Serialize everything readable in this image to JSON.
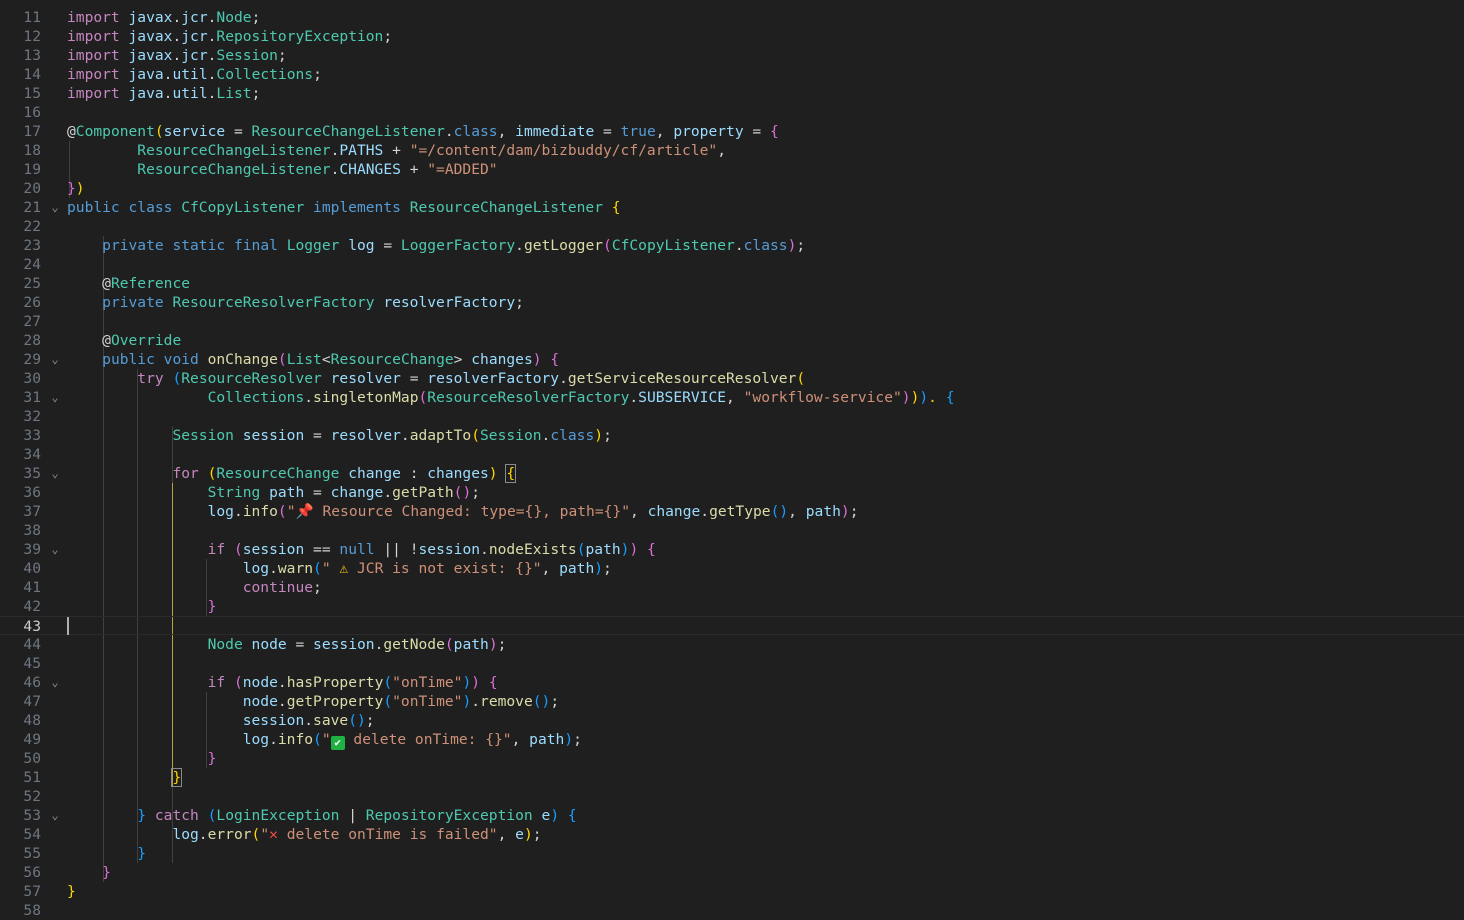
{
  "editor": {
    "active_line": 43,
    "colors": {
      "background": "#1f1f1f",
      "line_number": "#6e7681",
      "keyword": "#569cd6",
      "control": "#c586c0",
      "type": "#4ec9b0",
      "variable": "#9cdcfe",
      "function": "#dcdcaa",
      "string": "#ce9178"
    },
    "line_numbers": [
      "11",
      "12",
      "13",
      "14",
      "15",
      "16",
      "17",
      "18",
      "19",
      "20",
      "21",
      "22",
      "23",
      "24",
      "25",
      "26",
      "27",
      "28",
      "29",
      "30",
      "31",
      "32",
      "33",
      "34",
      "35",
      "36",
      "37",
      "38",
      "39",
      "40",
      "41",
      "42",
      "43",
      "44",
      "45",
      "46",
      "47",
      "48",
      "49",
      "50",
      "51",
      "52",
      "53",
      "54",
      "55",
      "56",
      "57",
      "58"
    ],
    "lines": [
      [
        [
          "kc",
          "import "
        ],
        [
          "v",
          "javax"
        ],
        [
          "p",
          "."
        ],
        [
          "v",
          "jcr"
        ],
        [
          "p",
          "."
        ],
        [
          "t",
          "Node"
        ],
        [
          "p",
          ";"
        ]
      ],
      [
        [
          "kc",
          "import "
        ],
        [
          "v",
          "javax"
        ],
        [
          "p",
          "."
        ],
        [
          "v",
          "jcr"
        ],
        [
          "p",
          "."
        ],
        [
          "t",
          "RepositoryException"
        ],
        [
          "p",
          ";"
        ]
      ],
      [
        [
          "kc",
          "import "
        ],
        [
          "v",
          "javax"
        ],
        [
          "p",
          "."
        ],
        [
          "v",
          "jcr"
        ],
        [
          "p",
          "."
        ],
        [
          "t",
          "Session"
        ],
        [
          "p",
          ";"
        ]
      ],
      [
        [
          "kc",
          "import "
        ],
        [
          "v",
          "java"
        ],
        [
          "p",
          "."
        ],
        [
          "v",
          "util"
        ],
        [
          "p",
          "."
        ],
        [
          "t",
          "Collections"
        ],
        [
          "p",
          ";"
        ]
      ],
      [
        [
          "kc",
          "import "
        ],
        [
          "v",
          "java"
        ],
        [
          "p",
          "."
        ],
        [
          "v",
          "util"
        ],
        [
          "p",
          "."
        ],
        [
          "t",
          "List"
        ],
        [
          "p",
          ";"
        ]
      ],
      [],
      [
        [
          "p",
          "@"
        ],
        [
          "t",
          "Component"
        ],
        [
          "b1",
          "("
        ],
        [
          "v",
          "service"
        ],
        [
          "p",
          " = "
        ],
        [
          "t",
          "ResourceChangeListener"
        ],
        [
          "p",
          "."
        ],
        [
          "k",
          "class"
        ],
        [
          "p",
          ", "
        ],
        [
          "v",
          "immediate"
        ],
        [
          "p",
          " = "
        ],
        [
          "k",
          "true"
        ],
        [
          "p",
          ", "
        ],
        [
          "v",
          "property"
        ],
        [
          "p",
          " = "
        ],
        [
          "b2",
          "{"
        ]
      ],
      [
        [
          "p",
          "        "
        ],
        [
          "t",
          "ResourceChangeListener"
        ],
        [
          "p",
          "."
        ],
        [
          "v",
          "PATHS"
        ],
        [
          "p",
          " + "
        ],
        [
          "s",
          "\"=/content/dam/bizbuddy/cf/article\""
        ],
        [
          "p",
          ","
        ]
      ],
      [
        [
          "p",
          "        "
        ],
        [
          "t",
          "ResourceChangeListener"
        ],
        [
          "p",
          "."
        ],
        [
          "v",
          "CHANGES"
        ],
        [
          "p",
          " + "
        ],
        [
          "s",
          "\"=ADDED\""
        ]
      ],
      [
        [
          "b2",
          "}"
        ],
        [
          "b1",
          ")"
        ]
      ],
      [
        [
          "k",
          "public "
        ],
        [
          "k",
          "class "
        ],
        [
          "t",
          "CfCopyListener "
        ],
        [
          "k",
          "implements "
        ],
        [
          "t",
          "ResourceChangeListener "
        ],
        [
          "b1",
          "{"
        ]
      ],
      [],
      [
        [
          "p",
          "    "
        ],
        [
          "k",
          "private "
        ],
        [
          "k",
          "static "
        ],
        [
          "k",
          "final "
        ],
        [
          "t",
          "Logger "
        ],
        [
          "v",
          "log"
        ],
        [
          "p",
          " = "
        ],
        [
          "t",
          "LoggerFactory"
        ],
        [
          "p",
          "."
        ],
        [
          "f",
          "getLogger"
        ],
        [
          "b2",
          "("
        ],
        [
          "t",
          "CfCopyListener"
        ],
        [
          "p",
          "."
        ],
        [
          "k",
          "class"
        ],
        [
          "b2",
          ")"
        ],
        [
          "p",
          ";"
        ]
      ],
      [],
      [
        [
          "p",
          "    @"
        ],
        [
          "t",
          "Reference"
        ]
      ],
      [
        [
          "p",
          "    "
        ],
        [
          "k",
          "private "
        ],
        [
          "t",
          "ResourceResolverFactory "
        ],
        [
          "v",
          "resolverFactory"
        ],
        [
          "p",
          ";"
        ]
      ],
      [],
      [
        [
          "p",
          "    @"
        ],
        [
          "t",
          "Override"
        ]
      ],
      [
        [
          "p",
          "    "
        ],
        [
          "k",
          "public "
        ],
        [
          "k",
          "void "
        ],
        [
          "f",
          "onChange"
        ],
        [
          "b2",
          "("
        ],
        [
          "t",
          "List"
        ],
        [
          "p",
          "<"
        ],
        [
          "t",
          "ResourceChange"
        ],
        [
          "p",
          "> "
        ],
        [
          "v",
          "changes"
        ],
        [
          "b2",
          ")"
        ],
        [
          "p",
          " "
        ],
        [
          "b2",
          "{"
        ]
      ],
      [
        [
          "p",
          "        "
        ],
        [
          "kc",
          "try "
        ],
        [
          "b3",
          "("
        ],
        [
          "t",
          "ResourceResolver "
        ],
        [
          "v",
          "resolver"
        ],
        [
          "p",
          " = "
        ],
        [
          "v",
          "resolverFactory"
        ],
        [
          "p",
          "."
        ],
        [
          "f",
          "getServiceResourceResolver"
        ],
        [
          "b1",
          "("
        ]
      ],
      [
        [
          "p",
          "                "
        ],
        [
          "t",
          "Collections"
        ],
        [
          "p",
          "."
        ],
        [
          "f",
          "singletonMap"
        ],
        [
          "b2",
          "("
        ],
        [
          "t",
          "ResourceResolverFactory"
        ],
        [
          "p",
          "."
        ],
        [
          "v",
          "SUBSERVICE"
        ],
        [
          "p",
          ", "
        ],
        [
          "s",
          "\"workflow-service\""
        ],
        [
          "b2",
          ")"
        ],
        [
          "b1",
          ")"
        ],
        [
          "b3",
          ")"
        ],
        [
          "bulb",
          "."
        ],
        [
          "p",
          " "
        ],
        [
          "b3",
          "{"
        ]
      ],
      [],
      [
        [
          "p",
          "            "
        ],
        [
          "t",
          "Session "
        ],
        [
          "v",
          "session"
        ],
        [
          "p",
          " = "
        ],
        [
          "v",
          "resolver"
        ],
        [
          "p",
          "."
        ],
        [
          "f",
          "adaptTo"
        ],
        [
          "b1",
          "("
        ],
        [
          "t",
          "Session"
        ],
        [
          "p",
          "."
        ],
        [
          "k",
          "class"
        ],
        [
          "b1",
          ")"
        ],
        [
          "p",
          ";"
        ]
      ],
      [],
      [
        [
          "p",
          "            "
        ],
        [
          "kc",
          "for "
        ],
        [
          "b1",
          "("
        ],
        [
          "t",
          "ResourceChange "
        ],
        [
          "v",
          "change"
        ],
        [
          "p",
          " : "
        ],
        [
          "v",
          "changes"
        ],
        [
          "b1",
          ")"
        ],
        [
          "p",
          " "
        ],
        [
          "b1 bm",
          "{"
        ]
      ],
      [
        [
          "p",
          "                "
        ],
        [
          "t",
          "String "
        ],
        [
          "v",
          "path"
        ],
        [
          "p",
          " = "
        ],
        [
          "v",
          "change"
        ],
        [
          "p",
          "."
        ],
        [
          "f",
          "getPath"
        ],
        [
          "b2",
          "()"
        ],
        [
          "p",
          ";"
        ]
      ],
      [
        [
          "p",
          "                "
        ],
        [
          "v",
          "log"
        ],
        [
          "p",
          "."
        ],
        [
          "f",
          "info"
        ],
        [
          "b2",
          "("
        ],
        [
          "s",
          "\""
        ],
        [
          "emoji-red",
          "📌"
        ],
        [
          "s",
          " Resource Changed: type={}, path={}\""
        ],
        [
          "p",
          ", "
        ],
        [
          "v",
          "change"
        ],
        [
          "p",
          "."
        ],
        [
          "f",
          "getType"
        ],
        [
          "b3",
          "()"
        ],
        [
          "p",
          ", "
        ],
        [
          "v",
          "path"
        ],
        [
          "b2",
          ")"
        ],
        [
          "p",
          ";"
        ]
      ],
      [],
      [
        [
          "p",
          "                "
        ],
        [
          "kc",
          "if "
        ],
        [
          "b2",
          "("
        ],
        [
          "v",
          "session"
        ],
        [
          "p",
          " == "
        ],
        [
          "k",
          "null"
        ],
        [
          "p",
          " || !"
        ],
        [
          "v",
          "session"
        ],
        [
          "p",
          "."
        ],
        [
          "f",
          "nodeExists"
        ],
        [
          "b3",
          "("
        ],
        [
          "v",
          "path"
        ],
        [
          "b3",
          ")"
        ],
        [
          "b2",
          ")"
        ],
        [
          "p",
          " "
        ],
        [
          "b2",
          "{"
        ]
      ],
      [
        [
          "p",
          "                    "
        ],
        [
          "v",
          "log"
        ],
        [
          "p",
          "."
        ],
        [
          "f",
          "warn"
        ],
        [
          "b3",
          "("
        ],
        [
          "s",
          "\" "
        ],
        [
          "emoji-warn",
          "⚠"
        ],
        [
          "s",
          " JCR is not exist: {}\""
        ],
        [
          "p",
          ", "
        ],
        [
          "v",
          "path"
        ],
        [
          "b3",
          ")"
        ],
        [
          "p",
          ";"
        ]
      ],
      [
        [
          "p",
          "                    "
        ],
        [
          "kc",
          "continue"
        ],
        [
          "p",
          ";"
        ]
      ],
      [
        [
          "p",
          "                "
        ],
        [
          "b2",
          "}"
        ]
      ],
      [],
      [
        [
          "p",
          "                "
        ],
        [
          "t",
          "Node "
        ],
        [
          "v",
          "node"
        ],
        [
          "p",
          " = "
        ],
        [
          "v",
          "session"
        ],
        [
          "p",
          "."
        ],
        [
          "f",
          "getNode"
        ],
        [
          "b2",
          "("
        ],
        [
          "v",
          "path"
        ],
        [
          "b2",
          ")"
        ],
        [
          "p",
          ";"
        ]
      ],
      [],
      [
        [
          "p",
          "                "
        ],
        [
          "kc",
          "if "
        ],
        [
          "b2",
          "("
        ],
        [
          "v",
          "node"
        ],
        [
          "p",
          "."
        ],
        [
          "f",
          "hasProperty"
        ],
        [
          "b3",
          "("
        ],
        [
          "s",
          "\"onTime\""
        ],
        [
          "b3",
          ")"
        ],
        [
          "b2",
          ")"
        ],
        [
          "p",
          " "
        ],
        [
          "b2",
          "{"
        ]
      ],
      [
        [
          "p",
          "                    "
        ],
        [
          "v",
          "node"
        ],
        [
          "p",
          "."
        ],
        [
          "f",
          "getProperty"
        ],
        [
          "b3",
          "("
        ],
        [
          "s",
          "\"onTime\""
        ],
        [
          "b3",
          ")"
        ],
        [
          "p",
          "."
        ],
        [
          "f",
          "remove"
        ],
        [
          "b3",
          "()"
        ],
        [
          "p",
          ";"
        ]
      ],
      [
        [
          "p",
          "                    "
        ],
        [
          "v",
          "session"
        ],
        [
          "p",
          "."
        ],
        [
          "f",
          "save"
        ],
        [
          "b3",
          "()"
        ],
        [
          "p",
          ";"
        ]
      ],
      [
        [
          "p",
          "                    "
        ],
        [
          "v",
          "log"
        ],
        [
          "p",
          "."
        ],
        [
          "f",
          "info"
        ],
        [
          "b3",
          "("
        ],
        [
          "s",
          "\""
        ],
        [
          "check",
          "✔"
        ],
        [
          "s",
          " delete onTime: {}\""
        ],
        [
          "p",
          ", "
        ],
        [
          "v",
          "path"
        ],
        [
          "b3",
          ")"
        ],
        [
          "p",
          ";"
        ]
      ],
      [
        [
          "p",
          "                "
        ],
        [
          "b2",
          "}"
        ]
      ],
      [
        [
          "p",
          "            "
        ],
        [
          "b1 bm",
          "}"
        ]
      ],
      [],
      [
        [
          "p",
          "        "
        ],
        [
          "b3",
          "}"
        ],
        [
          "p",
          " "
        ],
        [
          "kc",
          "catch "
        ],
        [
          "b3",
          "("
        ],
        [
          "t",
          "LoginException"
        ],
        [
          "p",
          " | "
        ],
        [
          "t",
          "RepositoryException "
        ],
        [
          "v",
          "e"
        ],
        [
          "b3",
          ")"
        ],
        [
          "p",
          " "
        ],
        [
          "b3",
          "{"
        ]
      ],
      [
        [
          "p",
          "            "
        ],
        [
          "v",
          "log"
        ],
        [
          "p",
          "."
        ],
        [
          "f",
          "error"
        ],
        [
          "b1",
          "("
        ],
        [
          "s",
          "\""
        ],
        [
          "emoji-red",
          "✕"
        ],
        [
          "s",
          " delete onTime is failed\""
        ],
        [
          "p",
          ", "
        ],
        [
          "v",
          "e"
        ],
        [
          "b1",
          ")"
        ],
        [
          "p",
          ";"
        ]
      ],
      [
        [
          "p",
          "        "
        ],
        [
          "b3",
          "}"
        ]
      ],
      [
        [
          "p",
          "    "
        ],
        [
          "b2",
          "}"
        ]
      ],
      [
        [
          "b1",
          "}"
        ]
      ],
      []
    ],
    "fold_markers": [
      "21",
      "29",
      "31",
      "35",
      "39",
      "46",
      "53"
    ]
  }
}
